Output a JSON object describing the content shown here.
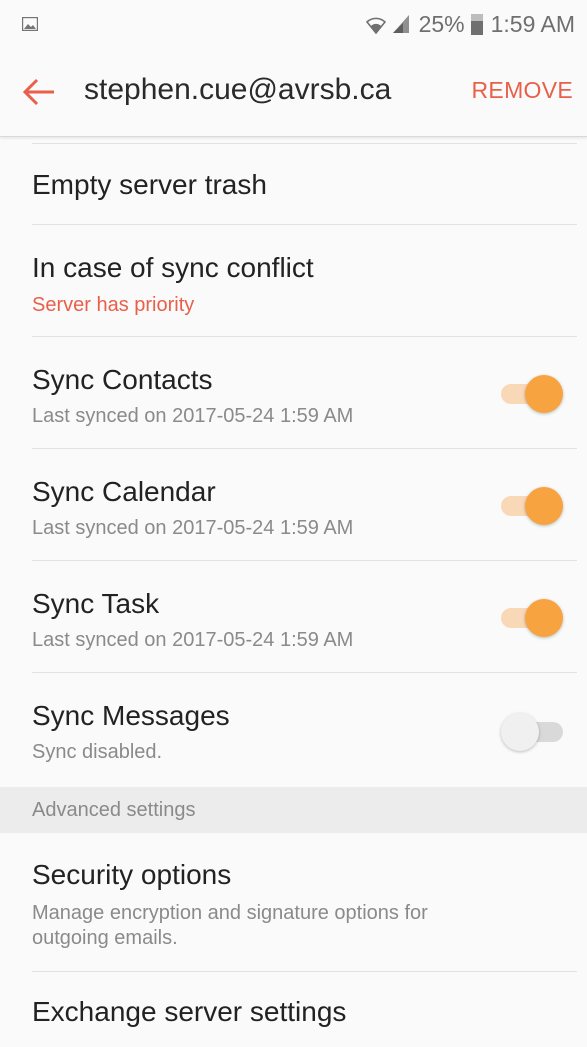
{
  "status_bar": {
    "battery": "25%",
    "time": "1:59 AM",
    "icons": [
      "gallery-icon",
      "wifi-icon",
      "signal-icon",
      "battery-icon"
    ]
  },
  "app_bar": {
    "title": "stephen.cue@avrsb.ca",
    "action": "REMOVE",
    "accent_color": "#e8604a"
  },
  "items": {
    "empty_trash": {
      "title": "Empty server trash"
    },
    "sync_conflict": {
      "title": "In case of sync conflict",
      "subtitle": "Server has priority"
    },
    "sync_contacts": {
      "title": "Sync Contacts",
      "subtitle": "Last synced on 2017-05-24  1:59 AM",
      "enabled": true
    },
    "sync_calendar": {
      "title": "Sync Calendar",
      "subtitle": "Last synced on 2017-05-24  1:59 AM",
      "enabled": true
    },
    "sync_task": {
      "title": "Sync Task",
      "subtitle": "Last synced on 2017-05-24  1:59 AM",
      "enabled": true
    },
    "sync_messages": {
      "title": "Sync Messages",
      "subtitle": "Sync disabled.",
      "enabled": false
    }
  },
  "advanced_header": "Advanced settings",
  "advanced_items": {
    "security": {
      "title": "Security options",
      "subtitle": "Manage encryption and signature options for outgoing emails."
    },
    "exchange": {
      "title": "Exchange server settings"
    }
  },
  "colors": {
    "toggle_on_thumb": "#f7a340",
    "toggle_on_track": "#f9d8b7",
    "toggle_off_thumb": "#f0f0f0",
    "toggle_off_track": "#d9d9d9"
  }
}
